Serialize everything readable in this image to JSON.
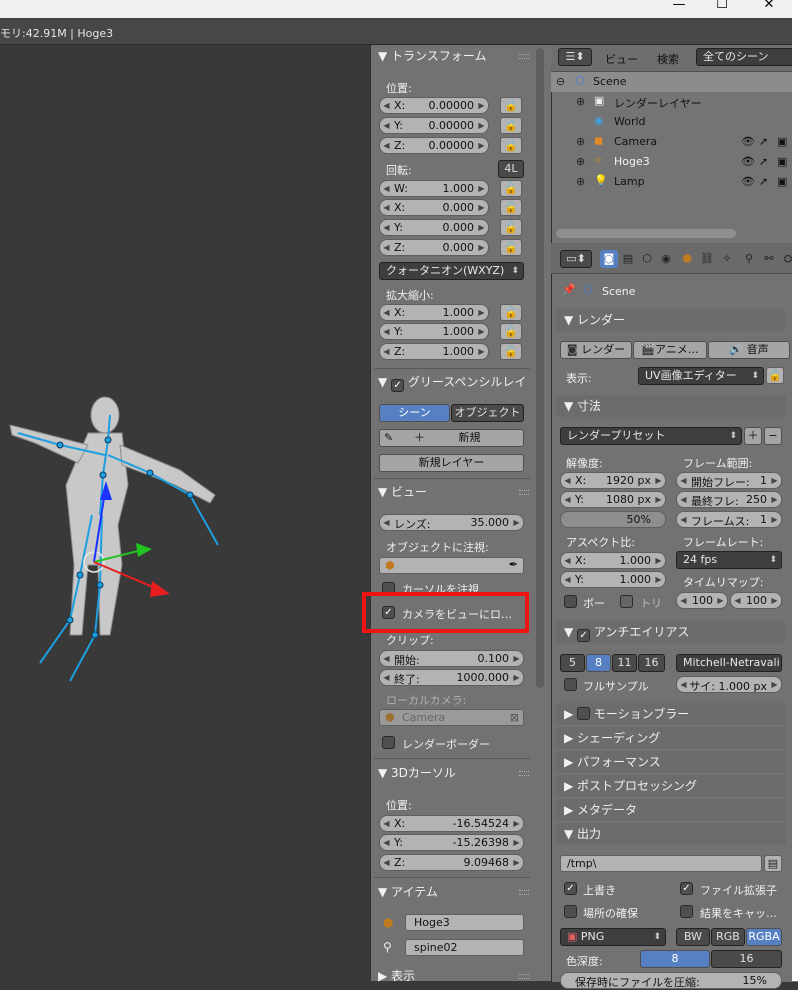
{
  "window": {
    "minimize": "—",
    "maximize": "☐",
    "close": "✕"
  },
  "infobar": {
    "text": "モリ:42.91M | Hoge3"
  },
  "npanel": {
    "transform": {
      "title": "トランスフォーム",
      "location_label": "位置:",
      "location": [
        {
          "axis": "X:",
          "value": "0.00000"
        },
        {
          "axis": "Y:",
          "value": "0.00000"
        },
        {
          "axis": "Z:",
          "value": "0.00000"
        }
      ],
      "rotation_label": "回転:",
      "rotation_mode_btn": "4L",
      "rotation": [
        {
          "axis": "W:",
          "value": "1.000"
        },
        {
          "axis": "X:",
          "value": "0.000"
        },
        {
          "axis": "Y:",
          "value": "0.000"
        },
        {
          "axis": "Z:",
          "value": "0.000"
        }
      ],
      "rotation_mode": "クォータニオン(WXYZ)",
      "scale_label": "拡大縮小:",
      "scale": [
        {
          "axis": "X:",
          "value": "1.000"
        },
        {
          "axis": "Y:",
          "value": "1.000"
        },
        {
          "axis": "Z:",
          "value": "1.000"
        }
      ]
    },
    "grease": {
      "title": "グリースペンシルレイ",
      "scene_btn": "シーン",
      "object_btn": "オブジェクト",
      "new_btn": "新規",
      "new_layer_btn": "新規レイヤー"
    },
    "view": {
      "title": "ビュー",
      "lens_label": "レンズ:",
      "lens_value": "35.000",
      "lock_object_label": "オブジェクトに注視:",
      "cursor_lock_label": "カーソルを注視",
      "lock_camera_label": "カメラをビューにロ…",
      "clip_label": "クリップ:",
      "clip_start_label": "開始:",
      "clip_start": "0.100",
      "clip_end_label": "終了:",
      "clip_end": "1000.000",
      "local_camera_label": "ローカルカメラ:",
      "local_camera_value": "Camera",
      "render_border_label": "レンダーボーダー"
    },
    "cursor3d": {
      "title": "3Dカーソル",
      "location_label": "位置:",
      "location": [
        {
          "axis": "X:",
          "value": "-16.54524"
        },
        {
          "axis": "Y:",
          "value": "-15.26398"
        },
        {
          "axis": "Z:",
          "value": "9.09468"
        }
      ]
    },
    "item": {
      "title": "アイテム",
      "object_name": "Hoge3",
      "bone_name": "spine02"
    },
    "display": {
      "title": "表示"
    }
  },
  "outliner": {
    "view_menu": "ビュー",
    "search_menu": "検索",
    "scene_dropdown": "全てのシーン",
    "rows": [
      {
        "name": "Scene"
      },
      {
        "name": "レンダーレイヤー"
      },
      {
        "name": "World"
      },
      {
        "name": "Camera"
      },
      {
        "name": "Hoge3"
      },
      {
        "name": "Lamp"
      }
    ]
  },
  "properties": {
    "scene_label": "Scene",
    "render": {
      "title": "レンダー",
      "render_btn": "レンダー",
      "anim_btn": "アニメ…",
      "audio_btn": "音声",
      "display_label": "表示:",
      "display_value": "UV画像エディター"
    },
    "dimensions": {
      "title": "寸法",
      "preset": "レンダープリセット",
      "resolution_label": "解像度:",
      "res_x": {
        "axis": "X:",
        "value": "1920 px"
      },
      "res_y": {
        "axis": "Y:",
        "value": "1080 px"
      },
      "res_pct": "50%",
      "frame_range_label": "フレーム範囲:",
      "frame_start": {
        "axis": "開始フレー:",
        "value": "1"
      },
      "frame_end": {
        "axis": "最終フレ:",
        "value": "250"
      },
      "frame_step": {
        "axis": "フレームス:",
        "value": "1"
      },
      "aspect_label": "アスペクト比:",
      "aspect_x": {
        "axis": "X:",
        "value": "1.000"
      },
      "aspect_y": {
        "axis": "Y:",
        "value": "1.000"
      },
      "framerate_label": "フレームレート:",
      "framerate": "24 fps",
      "timeremap_label": "タイムリマップ:",
      "remap_old": "100",
      "remap_new": "100",
      "border_label": "ボー",
      "crop_label": "トリ"
    },
    "antialias": {
      "title": "アンチエイリアス",
      "samples": [
        "5",
        "8",
        "11",
        "16"
      ],
      "active_sample": "8",
      "filter": "Mitchell-Netravali",
      "full_sample_label": "フルサンプル",
      "size": "サイ: 1.000 px"
    },
    "collapsed": [
      "モーションブラー",
      "シェーディング",
      "パフォーマンス",
      "ポストプロセッシング",
      "メタデータ"
    ],
    "output": {
      "title": "出力",
      "path": "/tmp\\",
      "overwrite_label": "上書き",
      "file_ext_label": "ファイル拡張子",
      "placeholders_label": "場所の確保",
      "cache_label": "結果をキャッ…",
      "format": "PNG",
      "color_modes": [
        "BW",
        "RGB",
        "RGBA"
      ],
      "active_color_mode": "RGBA",
      "depth_label": "色深度:",
      "depth_8": "8",
      "depth_16": "16",
      "compress_label": "保存時にファイルを圧縮:",
      "compress_value": "15%"
    }
  }
}
